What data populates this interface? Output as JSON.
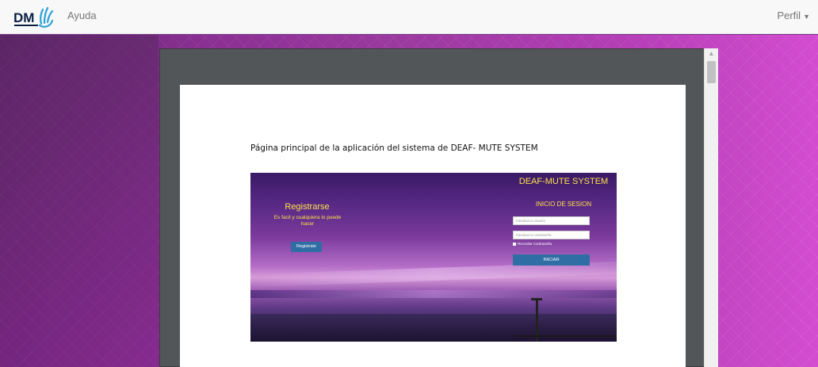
{
  "navbar": {
    "logo_text": "DM",
    "help_label": "Ayuda",
    "profile_label": "Perfil"
  },
  "document": {
    "caption": "Página principal  de la aplicación del sistema de DEAF- MUTE SYSTEM"
  },
  "embedded_screenshot": {
    "register_title": "Registrarse",
    "register_subtitle": "Es facil y cualquiera lo puede hacer",
    "register_button": "Registrate",
    "app_title": "DEAF-MUTE SYSTEM",
    "login_title": "INICIO DE SESION",
    "user_placeholder": "Introduzca usuario",
    "password_placeholder": "Introduzca contraseña",
    "remember_label": "Recordar Contraseña",
    "login_button": "INICIAR"
  },
  "colors": {
    "accent_yellow": "#ffe14a",
    "button_blue": "#2f6ea5",
    "navbar_bg": "#f8f8f8",
    "viewer_bg": "#525659"
  },
  "icons": {
    "logo": "dm-hand-logo",
    "profile_caret": "caret-down-icon",
    "scroll_up": "scroll-up-arrow-icon"
  }
}
